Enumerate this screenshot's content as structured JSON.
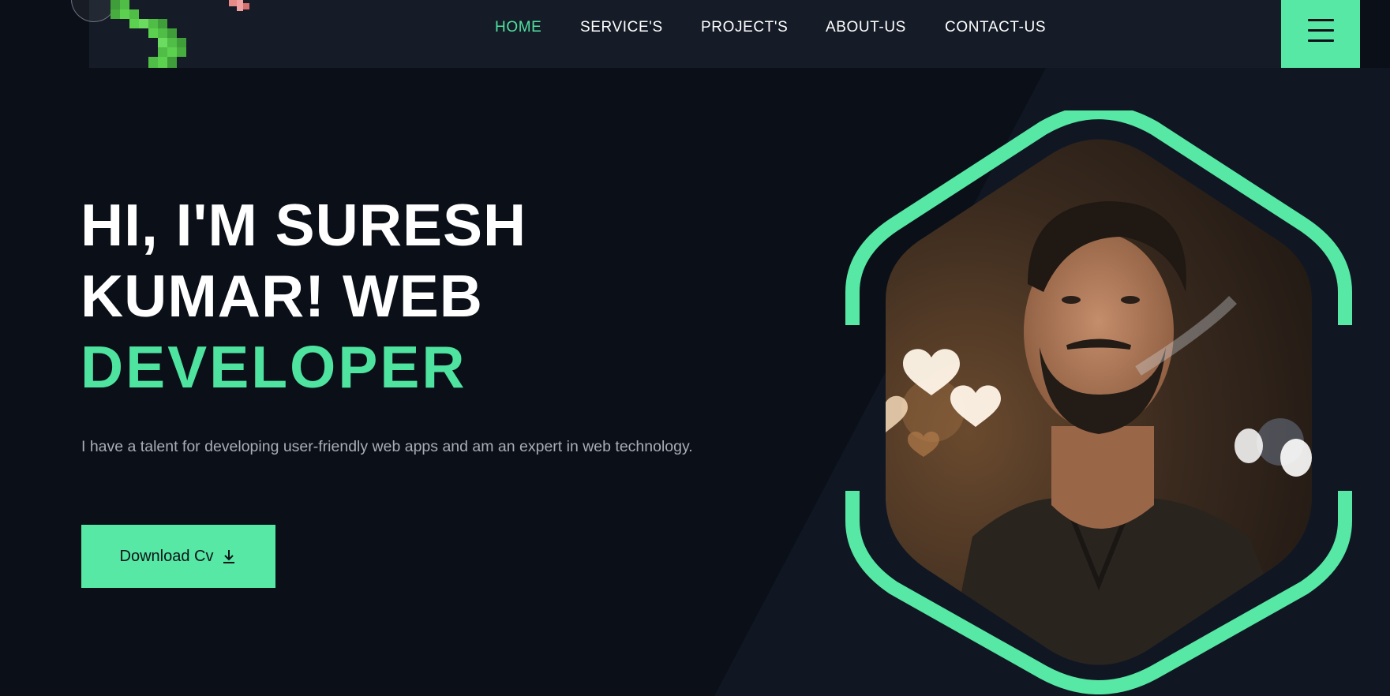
{
  "nav": {
    "items": [
      {
        "label": "HOME",
        "active": true
      },
      {
        "label": "SERVICE'S",
        "active": false
      },
      {
        "label": "PROJECT'S",
        "active": false
      },
      {
        "label": "ABOUT-US",
        "active": false
      },
      {
        "label": "CONTACT-US",
        "active": false
      }
    ],
    "menu_icon": "hamburger-menu-icon",
    "logo_icon": "snake-logo-icon"
  },
  "hero": {
    "title_line1": "HI, I'M SURESH",
    "title_line2": "KUMAR! WEB",
    "title_accent": "DEVELOPER",
    "description": "I have a talent for developing user-friendly web apps and am an expert in web technology.",
    "download_label": "Download Cv",
    "download_icon": "download-icon"
  },
  "colors": {
    "accent": "#56e8a4",
    "background": "#0a0f18",
    "navbar": "#161c27",
    "text_primary": "#ffffff",
    "text_muted": "#a8adb6"
  }
}
